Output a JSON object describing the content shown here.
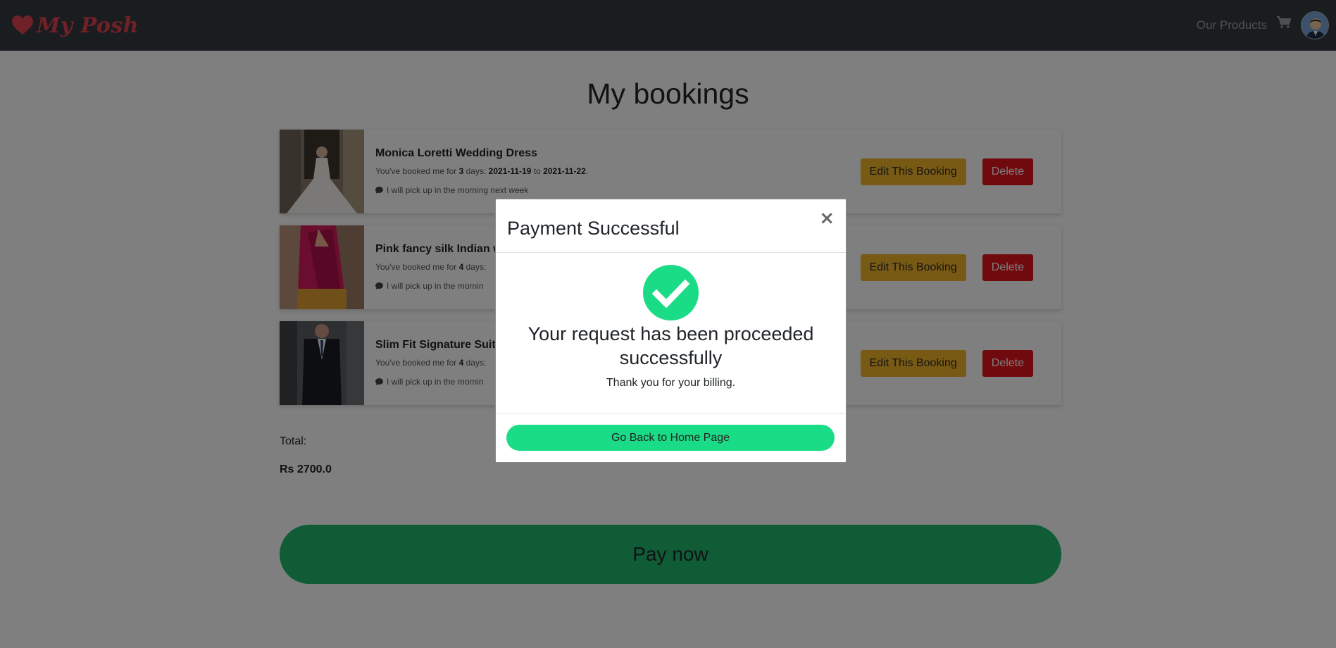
{
  "brand": {
    "name": "My Posh",
    "color": "#e0434e"
  },
  "nav": {
    "products_link": "Our Products",
    "cart_icon": "shopping-cart-icon"
  },
  "page": {
    "title": "My bookings"
  },
  "bookings": [
    {
      "name": "Monica Loretti Wedding Dress",
      "dates_prefix": "You've booked me for ",
      "days": "3",
      "days_suffix": " days: ",
      "from": "2021-11-19",
      "to_word": " to ",
      "to": "2021-11-22",
      "end": ".",
      "note": "I will pick up in the morning next week",
      "edit_label": "Edit This Booking",
      "delete_label": "Delete"
    },
    {
      "name": "Pink fancy silk Indian w",
      "dates_prefix": "You've booked me for ",
      "days": "4",
      "days_suffix": " days:",
      "note": "I will pick up in the mornin",
      "edit_label": "Edit This Booking",
      "delete_label": "Delete"
    },
    {
      "name": "Slim Fit Signature Suit",
      "dates_prefix": "You've booked me for ",
      "days": "4",
      "days_suffix": " days:",
      "note": "I will pick up in the mornin",
      "edit_label": "Edit This Booking",
      "delete_label": "Delete"
    }
  ],
  "total": {
    "label": "Total:",
    "value": "Rs 2700.0"
  },
  "pay_button": "Pay now",
  "modal": {
    "title": "Payment Successful",
    "close": "×",
    "heading": "Your request has been proceeded successfully",
    "message": "Thank you for your billing.",
    "button": "Go Back to Home Page",
    "icon": "check-circle-icon"
  },
  "colors": {
    "navbar": "#343a40",
    "edit": "#f0b429",
    "delete": "#e3141e",
    "pay": "#1fb96f",
    "success": "#1bdc86"
  }
}
